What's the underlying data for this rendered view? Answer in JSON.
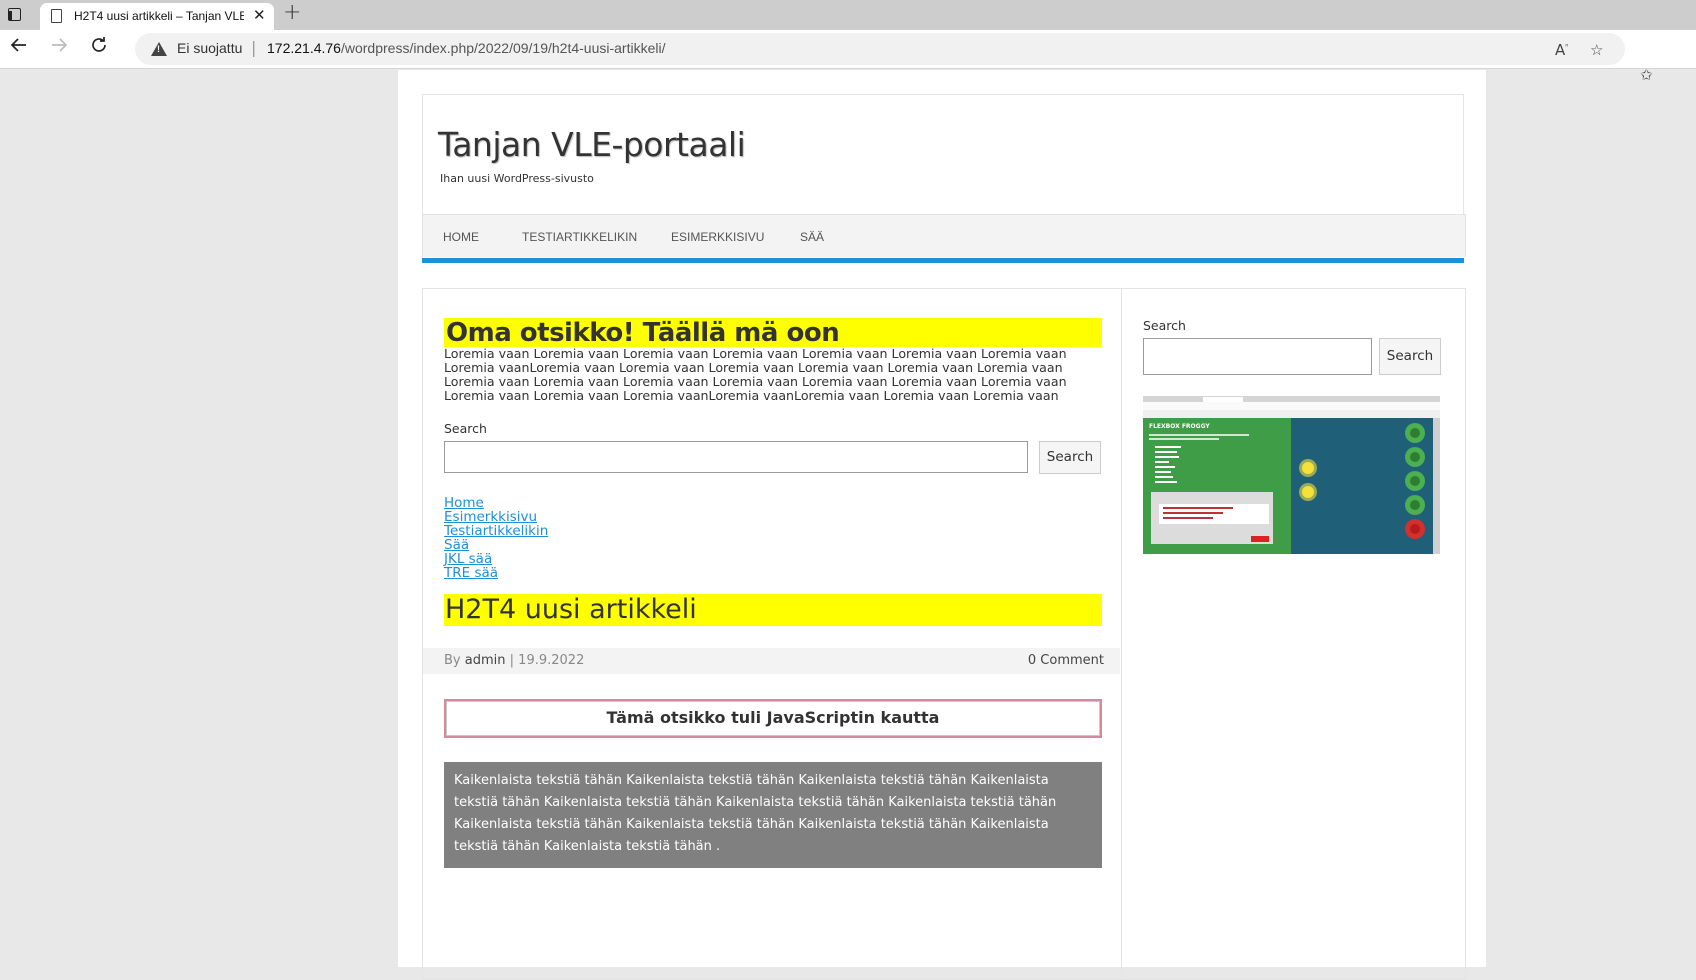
{
  "browser": {
    "tab_title": "H2T4 uusi artikkeli – Tanjan VLE-",
    "close_glyph": "✕",
    "new_tab_glyph": "+",
    "security_label": "Ei suojattu",
    "url_host": "172.21.4.76",
    "url_path": "/wordpress/index.php/2022/09/19/h2t4-uusi-artikkeli/"
  },
  "site": {
    "title": "Tanjan VLE-portaali",
    "description": "Ihan uusi WordPress-sivusto",
    "menu": [
      "HOME",
      "TESTIARTIKKELIKIN",
      "ESIMERKKISIVU",
      "SÄÄ"
    ]
  },
  "main": {
    "heading": "Oma otsikko! Täällä mä oon",
    "lorem": "Loremia vaan Loremia vaan Loremia vaan Loremia vaan Loremia vaan Loremia vaan Loremia vaan Loremia vaanLoremia vaan Loremia vaan Loremia vaan Loremia vaan Loremia vaan Loremia vaan Loremia vaan Loremia vaan Loremia vaan Loremia vaan Loremia vaan Loremia vaan Loremia vaan Loremia vaan Loremia vaan Loremia vaanLoremia vaanLoremia vaan Loremia vaan Loremia vaan",
    "search_label": "Search",
    "search_button": "Search",
    "links": [
      "Home",
      "Esimerkkisivu",
      "Testiartikkelikin",
      "Sää",
      "JKL sää",
      "TRE sää"
    ]
  },
  "post": {
    "title": "H2T4 uusi artikkeli",
    "by_label": "By",
    "author": "admin",
    "separator": "|",
    "date": "19.9.2022",
    "comments": "0 Comment",
    "js_heading": "Tämä otsikko tuli JavaScriptin kautta",
    "body": "Kaikenlaista tekstiä tähän Kaikenlaista tekstiä tähän Kaikenlaista tekstiä tähän Kaikenlaista tekstiä tähän Kaikenlaista tekstiä tähän Kaikenlaista tekstiä tähän Kaikenlaista tekstiä tähän Kaikenlaista tekstiä tähän Kaikenlaista tekstiä tähän Kaikenlaista tekstiä tähän Kaikenlaista tekstiä tähän Kaikenlaista tekstiä tähän ."
  },
  "sidebar": {
    "search_label": "Search",
    "search_button": "Search",
    "image_title": "FLEXBOX FROGGY"
  },
  "colors": {
    "accent": "#1e90d6",
    "highlight": "#ffff00",
    "gray_box": "#808080"
  }
}
